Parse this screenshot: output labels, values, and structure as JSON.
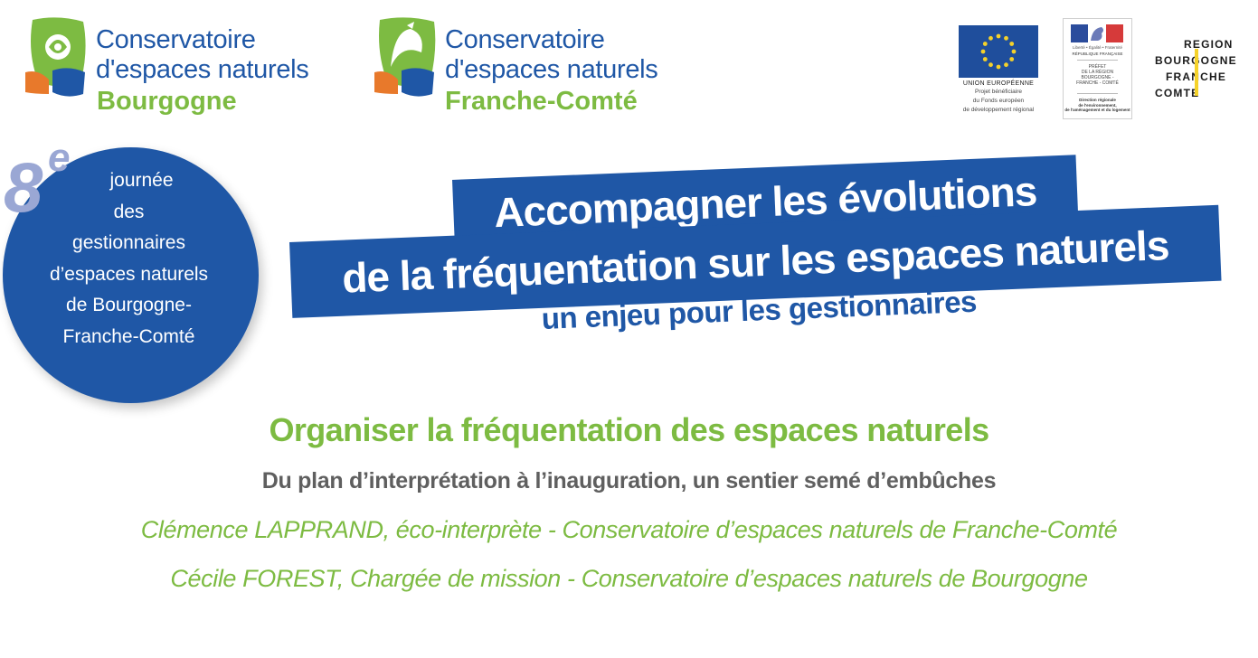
{
  "logos": {
    "cen_bourgogne": {
      "line1": "Conservatoire",
      "line2": "d'espaces naturels",
      "region": "Bourgogne"
    },
    "cen_franche_comte": {
      "line1": "Conservatoire",
      "line2": "d'espaces naturels",
      "region": "Franche-Comté"
    },
    "eu": {
      "title": "UNION EUROPÉENNE",
      "sub1": "Projet bénéficiaire",
      "sub2": "du Fonds européen",
      "sub3": "de développement régional"
    },
    "prefecture": {
      "motto": "Liberté • Égalité • Fraternité",
      "republic": "RÉPUBLIQUE FRANÇAISE",
      "prefet1": "PRÉFET",
      "prefet2": "DE LA RÉGION",
      "prefet3": "BOURGOGNE -",
      "prefet4": "FRANCHE - COMTÉ",
      "dir1": "Direction régionale",
      "dir2": "de l'environnement,",
      "dir3": "de l'aménagement et du logement"
    },
    "region": {
      "line1": "REGION",
      "line2": "BOURGOGNE",
      "line3": "FRANCHE",
      "line4": "COMTE"
    }
  },
  "edition": {
    "number": "8",
    "suffix": "e",
    "lines": [
      "journée",
      "des",
      "gestionnaires",
      "d’espaces naturels",
      "de Bourgogne-",
      "Franche-Comté"
    ]
  },
  "banner": {
    "line1": "Accompagner les évolutions",
    "line2": "de la fréquentation sur les espaces naturels",
    "tagline": "un enjeu pour les gestionnaires"
  },
  "talk": {
    "title": "Organiser la fréquentation des espaces naturels",
    "subtitle": "Du plan d’interprétation à l’inauguration, un sentier semé d’embûches",
    "speaker1": "Clémence LAPPRAND, éco-interprète - Conservatoire d’espaces naturels de Franche-Comté",
    "speaker2": "Cécile FOREST, Chargée de mission - Conservatoire d’espaces naturels de Bourgogne"
  },
  "colors": {
    "blue": "#1f57a6",
    "green": "#7dbb42",
    "grey": "#5f5f5f",
    "edition_number": "#9aa7d4",
    "region_accent": "#f5d22a"
  }
}
